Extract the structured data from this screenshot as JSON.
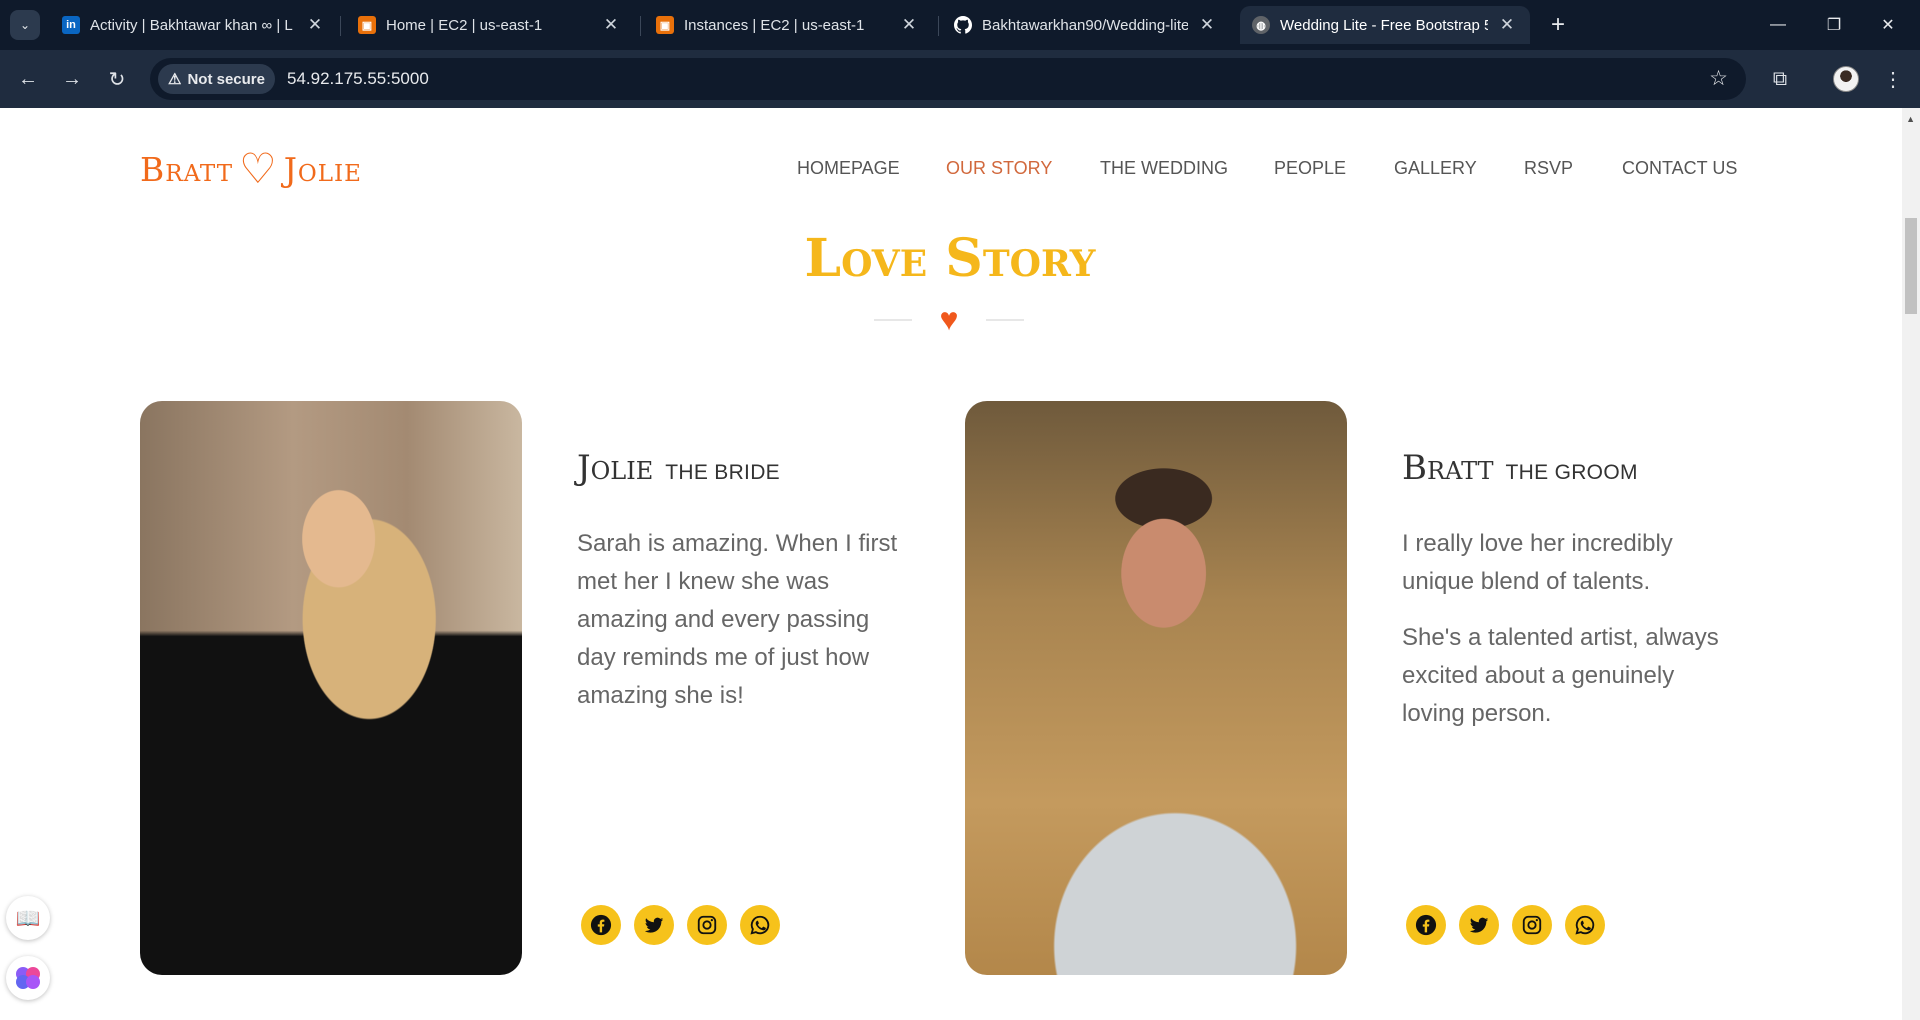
{
  "browser": {
    "tabs": [
      {
        "title": "Activity | Bakhtawar khan ∞ | L",
        "favicon": "linkedin-icon",
        "favicon_color": "#0a66c2"
      },
      {
        "title": "Home | EC2 | us-east-1",
        "favicon": "aws-ec2-icon",
        "favicon_color": "#e8700a"
      },
      {
        "title": "Instances | EC2 | us-east-1",
        "favicon": "aws-ec2-icon",
        "favicon_color": "#e8700a"
      },
      {
        "title": "Bakhtawarkhan90/Wedding-lite",
        "favicon": "github-icon",
        "favicon_color": "#ffffff"
      },
      {
        "title": "Wedding Lite - Free Bootstrap 5",
        "favicon": "globe-icon",
        "favicon_color": "#9aa0a6"
      }
    ],
    "security_label": "Not secure",
    "url": "54.92.175.55:5000"
  },
  "site": {
    "brand": {
      "left": "Bratt",
      "right": "Jolie"
    },
    "nav": [
      {
        "label": "HOMEPAGE",
        "active": false
      },
      {
        "label": "OUR STORY",
        "active": true
      },
      {
        "label": "THE WEDDING",
        "active": false
      },
      {
        "label": "PEOPLE",
        "active": false
      },
      {
        "label": "GALLERY",
        "active": false
      },
      {
        "label": "RSVP",
        "active": false
      },
      {
        "label": "CONTACT US",
        "active": false
      }
    ],
    "section_title": "Love Story",
    "bride": {
      "name": "Jolie",
      "role": "THE BRIDE",
      "paragraphs": [
        "Sarah is amazing. When I first met her I knew she was amazing and every passing day reminds me of just how amazing she is!"
      ]
    },
    "groom": {
      "name": "Bratt",
      "role": "THE GROOM",
      "paragraphs": [
        "I really love her incredibly unique blend of talents.",
        "She's a talented artist, always excited about a genuinely loving person."
      ]
    },
    "social_icons": [
      "facebook-icon",
      "twitter-icon",
      "instagram-icon",
      "whatsapp-icon"
    ]
  },
  "colors": {
    "accent_orange": "#f16a1b",
    "title_gold": "#f5b71b",
    "social_yellow": "#f6c21b",
    "nav_active": "#d1683c"
  }
}
